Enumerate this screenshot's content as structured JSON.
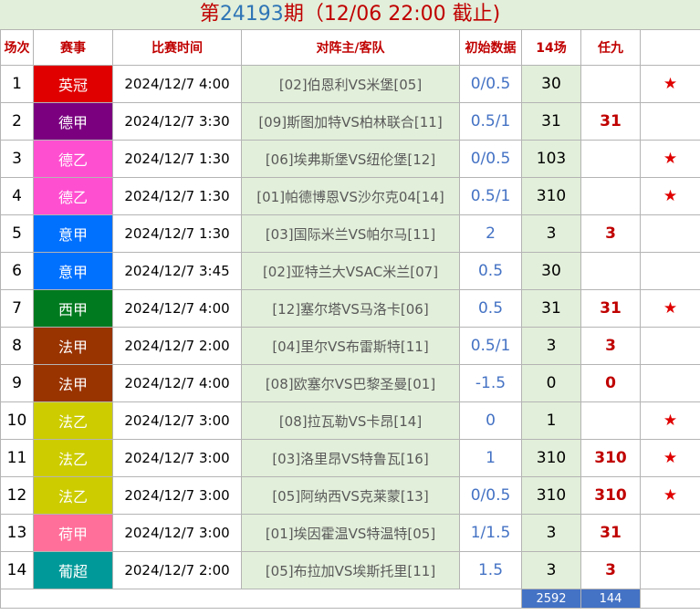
{
  "title": {
    "prefix": "第",
    "issue": "24193",
    "suffix": "期（12/06 22:00 截止)"
  },
  "headers": [
    "场次",
    "赛事",
    "比赛时间",
    "对阵主/客队",
    "初始数据",
    "14场",
    "任九",
    ""
  ],
  "rows": [
    {
      "no": "1",
      "league": "英冠",
      "color": "#e00000",
      "time": "2024/12/7 4:00",
      "match": "[02]伯恩利VS米堡[05]",
      "odds": "0/0.5",
      "p14": "30",
      "r9": "",
      "star": "★"
    },
    {
      "no": "2",
      "league": "德甲",
      "color": "#7b0080",
      "time": "2024/12/7 3:30",
      "match": "[09]斯图加特VS柏林联合[11]",
      "odds": "0.5/1",
      "p14": "31",
      "r9": "31",
      "star": ""
    },
    {
      "no": "3",
      "league": "德乙",
      "color": "#ff4fd1",
      "time": "2024/12/7 1:30",
      "match": "[06]埃弗斯堡VS纽伦堡[12]",
      "odds": "0/0.5",
      "p14": "103",
      "r9": "",
      "star": "★"
    },
    {
      "no": "4",
      "league": "德乙",
      "color": "#ff4fd1",
      "time": "2024/12/7 1:30",
      "match": "[01]帕德博恩VS沙尔克04[14]",
      "odds": "0.5/1",
      "p14": "310",
      "r9": "",
      "star": "★"
    },
    {
      "no": "5",
      "league": "意甲",
      "color": "#0070ff",
      "time": "2024/12/7 1:30",
      "match": "[03]国际米兰VS帕尔马[11]",
      "odds": "2",
      "p14": "3",
      "r9": "3",
      "star": ""
    },
    {
      "no": "6",
      "league": "意甲",
      "color": "#0070ff",
      "time": "2024/12/7 3:45",
      "match": "[02]亚特兰大VSAC米兰[07]",
      "odds": "0.5",
      "p14": "30",
      "r9": "",
      "star": ""
    },
    {
      "no": "7",
      "league": "西甲",
      "color": "#007a1f",
      "time": "2024/12/7 4:00",
      "match": "[12]塞尔塔VS马洛卡[06]",
      "odds": "0.5",
      "p14": "31",
      "r9": "31",
      "star": "★"
    },
    {
      "no": "8",
      "league": "法甲",
      "color": "#993300",
      "time": "2024/12/7 2:00",
      "match": "[04]里尔VS布雷斯特[11]",
      "odds": "0.5/1",
      "p14": "3",
      "r9": "3",
      "star": ""
    },
    {
      "no": "9",
      "league": "法甲",
      "color": "#993300",
      "time": "2024/12/7 4:00",
      "match": "[08]欧塞尔VS巴黎圣曼[01]",
      "odds": "-1.5",
      "p14": "0",
      "r9": "0",
      "star": ""
    },
    {
      "no": "10",
      "league": "法乙",
      "color": "#cccc00",
      "time": "2024/12/7 3:00",
      "match": "[08]拉瓦勒VS卡昂[14]",
      "odds": "0",
      "p14": "1",
      "r9": "",
      "star": "★"
    },
    {
      "no": "11",
      "league": "法乙",
      "color": "#cccc00",
      "time": "2024/12/7 3:00",
      "match": "[03]洛里昂VS特鲁瓦[16]",
      "odds": "1",
      "p14": "310",
      "r9": "310",
      "star": "★"
    },
    {
      "no": "12",
      "league": "法乙",
      "color": "#cccc00",
      "time": "2024/12/7 3:00",
      "match": "[05]阿纳西VS克莱蒙[13]",
      "odds": "0/0.5",
      "p14": "310",
      "r9": "310",
      "star": "★"
    },
    {
      "no": "13",
      "league": "荷甲",
      "color": "#ff6f9a",
      "time": "2024/12/7 3:00",
      "match": "[01]埃因霍温VS特温特[05]",
      "odds": "1/1.5",
      "p14": "3",
      "r9": "31",
      "star": ""
    },
    {
      "no": "14",
      "league": "葡超",
      "color": "#009999",
      "time": "2024/12/7 2:00",
      "match": "[05]布拉加VS埃斯托里[11]",
      "odds": "1.5",
      "p14": "3",
      "r9": "3",
      "star": ""
    }
  ],
  "totals": {
    "p14": "2592",
    "r9": "144"
  }
}
